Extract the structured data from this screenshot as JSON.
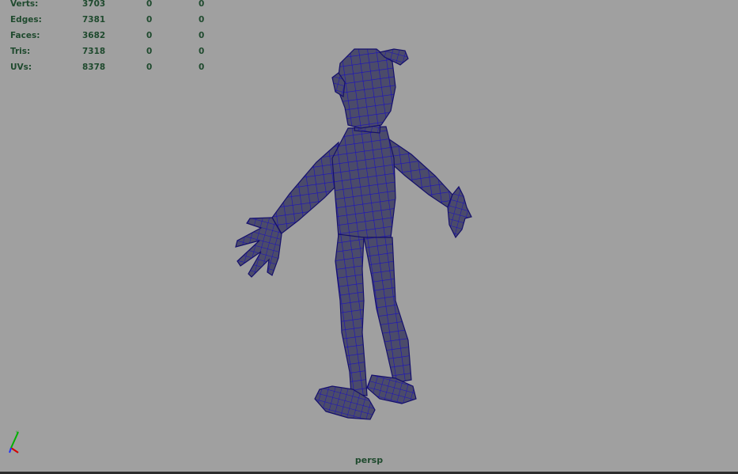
{
  "viewport": {
    "camera": "persp",
    "background": "#a0a0a0",
    "mesh_color": "#4b4b6a",
    "wire_color": "#0a00c8"
  },
  "hud": {
    "rows": [
      {
        "label": "Verts:",
        "values": [
          "3703",
          "0",
          "0"
        ]
      },
      {
        "label": "Edges:",
        "values": [
          "7381",
          "0",
          "0"
        ]
      },
      {
        "label": "Faces:",
        "values": [
          "3682",
          "0",
          "0"
        ]
      },
      {
        "label": "Tris:",
        "values": [
          "7318",
          "0",
          "0"
        ]
      },
      {
        "label": "UVs:",
        "values": [
          "8378",
          "0",
          "0"
        ]
      }
    ]
  },
  "axis_indicator": {
    "x_color": "#d40000",
    "y_color": "#00b000",
    "z_color": "#2030ff"
  }
}
